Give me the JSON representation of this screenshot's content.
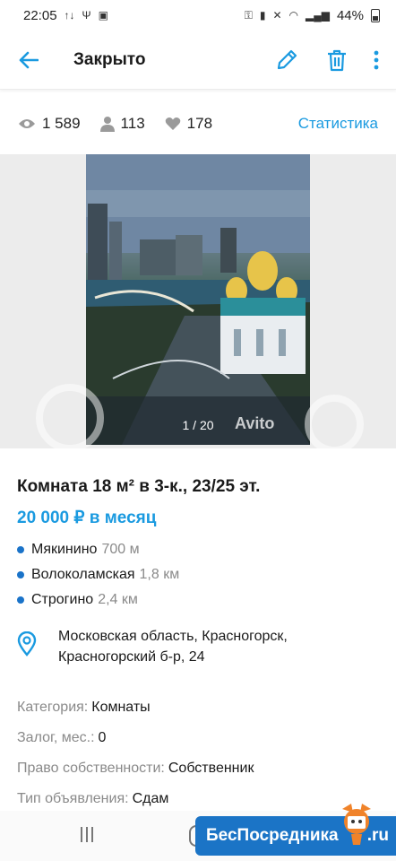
{
  "status_bar": {
    "time": "22:05",
    "battery": "44%"
  },
  "app_bar": {
    "title": "Закрыто"
  },
  "stats": {
    "views": "1 589",
    "contacts": "113",
    "favorites": "178",
    "link": "Статистика"
  },
  "gallery": {
    "counter": "1 / 20",
    "watermark": "Avito"
  },
  "listing": {
    "title": "Комната 18 м² в 3-к., 23/25 эт.",
    "price": "20 000 ₽ в месяц",
    "metro": [
      {
        "name": "Мякинино",
        "distance": "700 м"
      },
      {
        "name": "Волоколамская",
        "distance": "1,8 км"
      },
      {
        "name": "Строгино",
        "distance": "2,4 км"
      }
    ],
    "address_line1": "Московская область, Красногорск,",
    "address_line2": "Красногорский б-р, 24",
    "params": [
      {
        "key": "Категория:",
        "value": "Комнаты"
      },
      {
        "key": "Залог, мес.:",
        "value": "0"
      },
      {
        "key": "Право собственности:",
        "value": "Собственник"
      },
      {
        "key": "Тип объявления:",
        "value": "Сдам"
      }
    ]
  },
  "brand": {
    "name": "БесПосредника",
    "suffix": ".ru"
  },
  "colors": {
    "accent": "#1a9ae0",
    "metro_dot": "#1a73c9",
    "brand_bg": "#1b74c6"
  }
}
